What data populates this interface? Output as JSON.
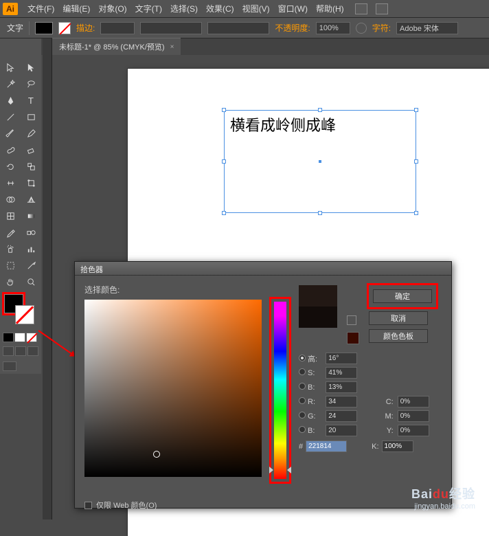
{
  "app": {
    "logo": "Ai"
  },
  "menu": {
    "items": [
      "文件(F)",
      "编辑(E)",
      "对象(O)",
      "文字(T)",
      "选择(S)",
      "效果(C)",
      "视图(V)",
      "窗口(W)",
      "帮助(H)"
    ]
  },
  "options": {
    "tool_label": "文字",
    "stroke_label": "描边:",
    "opacity_label": "不透明度:",
    "opacity_value": "100%",
    "char_label": "字符:",
    "font_value": "Adobe 宋体"
  },
  "tab": {
    "title": "未标题-1* @ 85% (CMYK/预览)",
    "close": "×"
  },
  "canvas": {
    "text": "横看成岭侧成峰"
  },
  "picker": {
    "title": "拾色器",
    "select_label": "选择颜色:",
    "ok": "确定",
    "cancel": "取消",
    "swatches": "颜色色板",
    "web_only": "仅限 Web 颜色(O)",
    "hsb": {
      "h_label": "高:",
      "s_label": "S:",
      "b_label": "B:",
      "h": "16°",
      "s": "41%",
      "b": "13%"
    },
    "rgb": {
      "r_label": "R:",
      "g_label": "G:",
      "b_label": "B:",
      "r": "34",
      "g": "24",
      "b": "20"
    },
    "cmyk": {
      "c_label": "C:",
      "m_label": "M:",
      "y_label": "Y:",
      "k_label": "K:",
      "c": "0%",
      "m": "0%",
      "y": "0%",
      "k": "100%"
    },
    "hex_label": "#",
    "hex": "221814"
  },
  "watermark": {
    "brand": "Bai",
    "du": "du",
    "suffix": "经验",
    "url": "jingyan.baidu.com"
  }
}
